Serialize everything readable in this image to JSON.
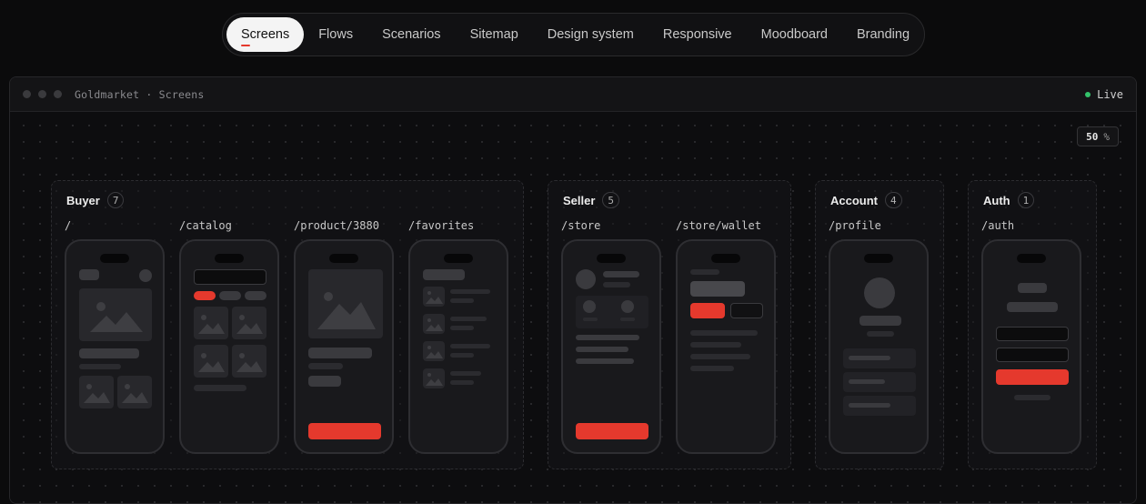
{
  "tabs": [
    "Screens",
    "Flows",
    "Scenarios",
    "Sitemap",
    "Design system",
    "Responsive",
    "Moodboard",
    "Branding"
  ],
  "active_tab": "Screens",
  "window": {
    "title": "Goldmarket · Screens",
    "status": "Live"
  },
  "zoom": {
    "value": "50",
    "unit": "%"
  },
  "groups": [
    {
      "name": "Buyer",
      "count": "7",
      "routes": [
        "/",
        "/catalog",
        "/product/3880",
        "/favorites"
      ]
    },
    {
      "name": "Seller",
      "count": "5",
      "routes": [
        "/store",
        "/store/wallet"
      ]
    },
    {
      "name": "Account",
      "count": "4",
      "routes": [
        "/profile"
      ]
    },
    {
      "name": "Auth",
      "count": "1",
      "routes": [
        "/auth"
      ]
    }
  ],
  "colors": {
    "accent": "#e5392d",
    "live": "#33c26a",
    "background": "#0b0b0c"
  }
}
